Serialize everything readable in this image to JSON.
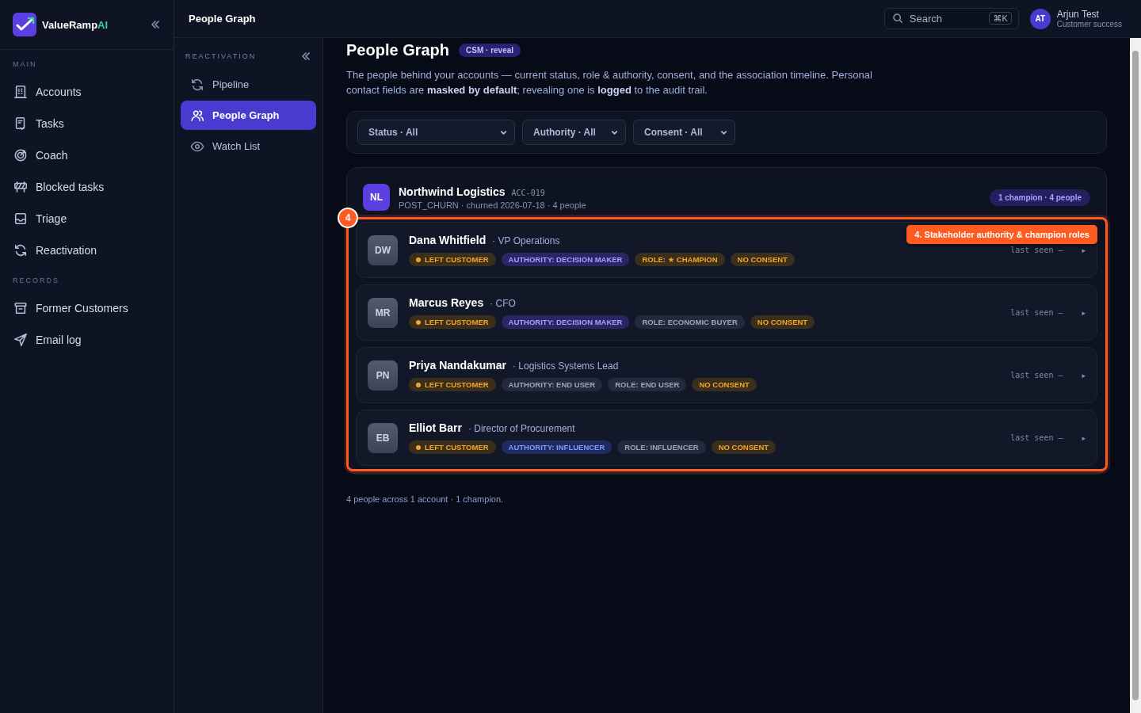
{
  "brand": {
    "name": "ValueRamp",
    "suffix": "AI"
  },
  "sidebar": {
    "sections": [
      {
        "title": "MAIN",
        "items": [
          {
            "label": "Accounts",
            "selected": false
          },
          {
            "label": "Tasks",
            "selected": false
          },
          {
            "label": "Coach",
            "selected": false
          },
          {
            "label": "Blocked tasks",
            "selected": false
          },
          {
            "label": "Triage",
            "selected": false
          },
          {
            "label": "Reactivation",
            "selected": false
          }
        ]
      },
      {
        "title": "RECORDS",
        "items": [
          {
            "label": "Former Customers",
            "selected": false
          },
          {
            "label": "Email log",
            "selected": false
          }
        ]
      }
    ]
  },
  "topbar": {
    "title": "People Graph",
    "search": {
      "placeholder": "Search",
      "shortcut": "⌘K"
    },
    "user": {
      "initials": "AT",
      "name": "Arjun Test",
      "role": "Customer success"
    }
  },
  "subnav": {
    "title": "REACTIVATION",
    "items": [
      {
        "label": "Pipeline",
        "selected": false
      },
      {
        "label": "People Graph",
        "selected": true
      },
      {
        "label": "Watch List",
        "selected": false
      }
    ]
  },
  "page": {
    "title": "People Graph",
    "badge": "CSM · reveal",
    "description": "The people behind your accounts — current status, role & authority, consent, and the association timeline. Personal contact fields are **masked by default**; revealing one is **logged** to the audit trail."
  },
  "filters": [
    {
      "value": "Status · All"
    },
    {
      "value": "Authority · All"
    },
    {
      "value": "Consent · All"
    }
  ],
  "account": {
    "initials": "NL",
    "name": "Northwind Logistics",
    "id": "ACC-019",
    "meta": "POST_CHURN · churned 2026-07-18 · 4 people",
    "summary": "1 champion · 4 people",
    "people": [
      {
        "initials": "DW",
        "name": "Dana Whitfield",
        "title": "· VP Operations",
        "last_seen": "last seen —",
        "arrow": "▸",
        "tags": [
          {
            "text": "LEFT CUSTOMER",
            "kind": "status"
          },
          {
            "text": "AUTHORITY: DECISION MAKER",
            "kind": "accent"
          },
          {
            "text": "ROLE: ★ CHAMPION",
            "kind": "warn"
          },
          {
            "text": "NO CONSENT",
            "kind": "warn"
          }
        ]
      },
      {
        "initials": "MR",
        "name": "Marcus Reyes",
        "title": "· CFO",
        "last_seen": "last seen —",
        "arrow": "▸",
        "tags": [
          {
            "text": "LEFT CUSTOMER",
            "kind": "status"
          },
          {
            "text": "AUTHORITY: DECISION MAKER",
            "kind": "accent"
          },
          {
            "text": "ROLE: ECONOMIC BUYER",
            "kind": "muted"
          },
          {
            "text": "NO CONSENT",
            "kind": "warn"
          }
        ]
      },
      {
        "initials": "PN",
        "name": "Priya Nandakumar",
        "title": "· Logistics Systems Lead",
        "last_seen": "last seen —",
        "arrow": "▸",
        "tags": [
          {
            "text": "LEFT CUSTOMER",
            "kind": "status"
          },
          {
            "text": "AUTHORITY: END USER",
            "kind": "muted"
          },
          {
            "text": "ROLE: END USER",
            "kind": "muted"
          },
          {
            "text": "NO CONSENT",
            "kind": "warn"
          }
        ]
      },
      {
        "initials": "EB",
        "name": "Elliot Barr",
        "title": "· Director of Procurement",
        "last_seen": "last seen —",
        "arrow": "▸",
        "tags": [
          {
            "text": "LEFT CUSTOMER",
            "kind": "status"
          },
          {
            "text": "AUTHORITY: INFLUENCER",
            "kind": "info"
          },
          {
            "text": "ROLE: INFLUENCER",
            "kind": "muted"
          },
          {
            "text": "NO CONSENT",
            "kind": "warn"
          }
        ]
      }
    ]
  },
  "annotation": {
    "number": "4",
    "label": "4. Stakeholder authority & champion roles"
  },
  "footer": "4 people across 1 account · 1 champion."
}
